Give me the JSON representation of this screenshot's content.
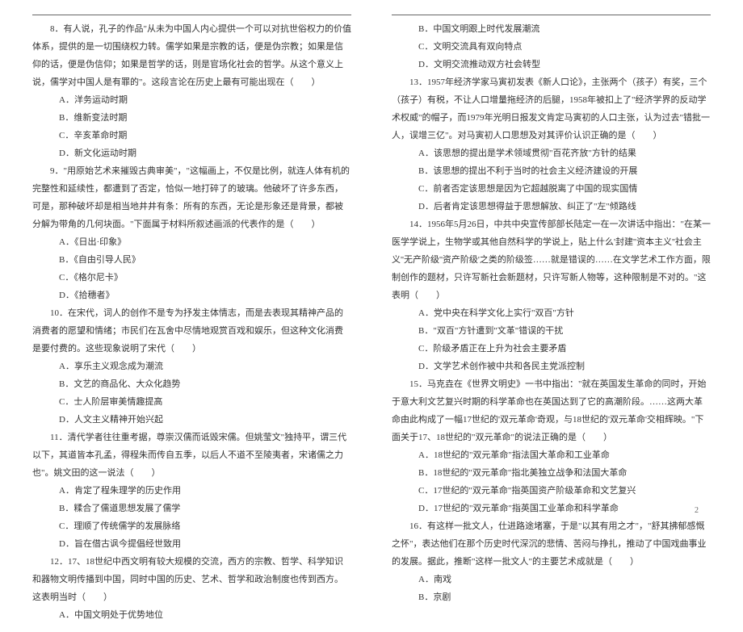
{
  "left": {
    "q8_intro": "8．有人说，孔子的作品\"从未为中国人内心提供一个可以对抗世俗权力的价值体系，提供的是一切围绕权力转。儒学如果是宗教的话，便是伪宗教；如果是信仰的话，便是伪信仰；如果是哲学的话，则是官场化社会的哲学。从这个意义上说，儒学对中国人是有罪的\"。这段言论在历史上最有可能出现在（　　）",
    "q8_A": "A．洋务运动时期",
    "q8_B": "B．维新变法时期",
    "q8_C": "C．辛亥革命时期",
    "q8_D": "D．新文化运动时期",
    "q9_intro": "9．\"用原始艺术来摧毁古典审美\"，\"这幅画上，不仅是比例，就连人体有机的完整性和延续性，都遭到了否定，恰似一地打碎了的玻璃。他破坏了许多东西，可是，那种破坏却是相当地井井有条：所有的东西，无论是形象还是背景，都被分解为带角的几何块面。\"下面属于材料所叙述画派的代表作的是（　　）",
    "q9_A": "A．《日出·印象》",
    "q9_B": "B．《自由引导人民》",
    "q9_C": "C．《格尔尼卡》",
    "q9_D": "D．《拾穗者》",
    "q10_intro": "10．在宋代，词人的创作不是专为抒发主体情志，而是去表现其精神产品的消费者的愿望和情绪；市民们在瓦舍中尽情地观赏百戏和娱乐，但这种文化消费是要付费的。这些现象说明了宋代（　　）",
    "q10_A": "A．享乐主义观念成为潮流",
    "q10_B": "B．文艺的商品化、大众化趋势",
    "q10_C": "C．士人阶层审美情趣提高",
    "q10_D": "D．人文主义精神开始兴起",
    "q11_intro": "11．清代学者往往重考据，尊崇汉儒而诋毁宋儒。但姚莹文\"独持平，谓三代以下，其道皆本孔孟，得程朱而传自五季，以后人不道不至陵夷者，宋诸儒之力也\"。姚文田的这一说法（　　）",
    "q11_A": "A．肯定了程朱理学的历史作用",
    "q11_B": "B．糅合了儒道思想发展了儒学",
    "q11_C": "C．理顺了传统儒学的发展脉络",
    "q11_D": "D．旨在借古讽今提倡经世致用",
    "q12_intro": "12．17、18世纪中西文明有较大规模的交流，西方的宗教、哲学、科学知识和器物文明传播到中国，同时中国的历史、艺术、哲学和政治制度也传到西方。这表明当时（　　）",
    "q12_A": "A．中国文明处于优势地位"
  },
  "right": {
    "q12_B": "B．中国文明跟上时代发展潮流",
    "q12_C": "C．文明交流具有双向特点",
    "q12_D": "D．文明交流推动双方社会转型",
    "q13_intro": "13．1957年经济学家马寅初发表《新人口论》，主张两个（孩子）有奖，三个（孩子）有税，不让人口增量拖经济的后腿，1958年被扣上了\"经济学界的反动学术权威\"的帽子，而1979年光明日报发文肯定马寅初的人口主张，认为过去\"错批一人，误增三亿\"。对马寅初人口思想及对其评价认识正确的是（　　）",
    "q13_A": "A．该思想的提出是学术领域贯彻\"百花齐放\"方针的结果",
    "q13_B": "B．该思想的提出不利于当时的社会主义经济建设的开展",
    "q13_C": "C．前者否定该思想是因为它超越脱离了中国的现实国情",
    "q13_D": "D．后者肯定该思想得益于思想解放、纠正了\"左\"倾路线",
    "q14_intro": "14．1956年5月26日，中共中央宣传部部长陆定一在一次讲话中指出：\"在某一医学学说上，生物学或其他自然科学的学说上，贴上什么'封建''资本主义''社会主义''无产阶级''资产阶级'之类的阶级签……就是错误的……在文学艺术工作方面，限制创作的题材，只许写新社会新题材，只许写新人物等，这种限制是不对的。\"这表明（　　）",
    "q14_A": "A．党中央在科学文化上实行\"双百\"方针",
    "q14_B": "B．\"双百\"方针遭到\"文革\"错误的干扰",
    "q14_C": "C．阶级矛盾正在上升为社会主要矛盾",
    "q14_D": "D．文学艺术创作被中共和各民主党派控制",
    "q15_intro": "15．马克垚在《世界文明史》一书中指出：\"就在英国发生革命的同时，开始于意大利文艺复兴时期的科学革命也在英国达到了它的高潮阶段。……这两大革命由此构成了一幅17世纪的'双元革命'奇观，与18世纪的'双元革命'交相辉映。\"下面关于17、18世纪的\"双元革命\"的说法正确的是（　　）",
    "q15_A": "A．18世纪的\"双元革命\"指法国大革命和工业革命",
    "q15_B": "B．18世纪的\"双元革命\"指北美独立战争和法国大革命",
    "q15_C": "C．17世纪的\"双元革命\"指英国资产阶级革命和文艺复兴",
    "q15_D": "D．17世纪的\"双元革命\"指英国工业革命和科学革命",
    "q16_intro": "16．有这样一批文人，仕进路途堵塞，于是\"以其有用之才\"，\"舒其拂郁感慨之怀\"，表达他们在那个历史时代深沉的悲情、苦闷与挣扎，推动了中国戏曲事业的发展。据此，推断\"这样一批文人\"的主要艺术成就是（　　）",
    "q16_A": "A．南戏",
    "q16_B": "B．京剧"
  },
  "pagenum": "2"
}
